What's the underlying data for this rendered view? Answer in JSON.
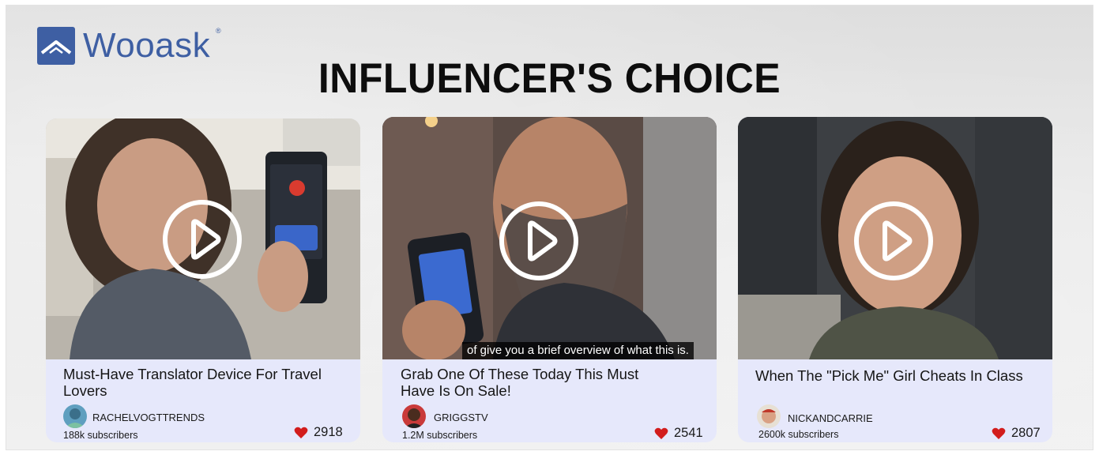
{
  "brand": {
    "name": "Wooask",
    "registered": "®",
    "color": "#3e5fa3",
    "icon": "mountain-roof-logo-icon"
  },
  "title": "INFLUENCER'S CHOICE",
  "cards": [
    {
      "title": "Must-Have Translator Device For Travel Lovers",
      "channel": "RACHELVOGTTRENDS",
      "subscribers": "188k  subscribers",
      "likes": "2918",
      "caption": "",
      "play_icon": "play-circle-icon",
      "like_icon": "heart-icon"
    },
    {
      "title": "Grab One Of These Today This Must Have Is On Sale!",
      "channel": "GRIGGSTV",
      "subscribers": "1.2M subscribers",
      "likes": "2541",
      "caption": "of give you a brief overview of what this is.",
      "play_icon": "play-circle-icon",
      "like_icon": "heart-icon"
    },
    {
      "title": "When The \"Pick Me\" Girl Cheats In Class",
      "channel": "NICKANDCARRIE",
      "subscribers": "2600k subscribers",
      "likes": "2807",
      "caption": "",
      "play_icon": "play-circle-icon",
      "like_icon": "heart-icon"
    }
  ],
  "colors": {
    "card_bg": "#e6e8fb",
    "heart": "#d21c1c",
    "title": "#0d0d0d"
  }
}
